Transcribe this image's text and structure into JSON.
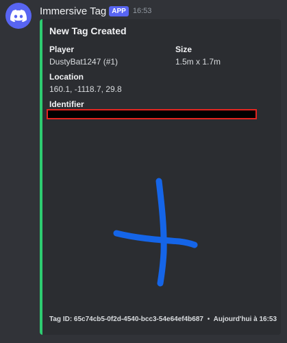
{
  "message": {
    "author": "Immersive Tag",
    "app_badge": "APP",
    "time": "16:53",
    "avatar_icon": "discord-logo-icon"
  },
  "embed": {
    "accent_color": "#2ecc71",
    "title": "New Tag Created",
    "fields": {
      "player": {
        "name": "Player",
        "value": "DustyBat1247 (#1)"
      },
      "size": {
        "name": "Size",
        "value": "1.5m x 1.7m"
      },
      "location": {
        "name": "Location",
        "value": "160.1, -1118.7, 29.8"
      },
      "identifier": {
        "name": "Identifier",
        "value": ""
      }
    },
    "image": "blue-cross-tag-drawing",
    "footer": {
      "tag_id": "Tag ID: 65c74cb5-0f2d-4540-bcc3-54e64ef4b687",
      "separator": "•",
      "date": "Aujourd'hui à 16:53"
    }
  },
  "colors": {
    "background": "#313338",
    "embed_background": "#2b2d31",
    "badge": "#5865f2",
    "redaction_border": "#e5241f",
    "tag_paint": "#1565e8"
  }
}
